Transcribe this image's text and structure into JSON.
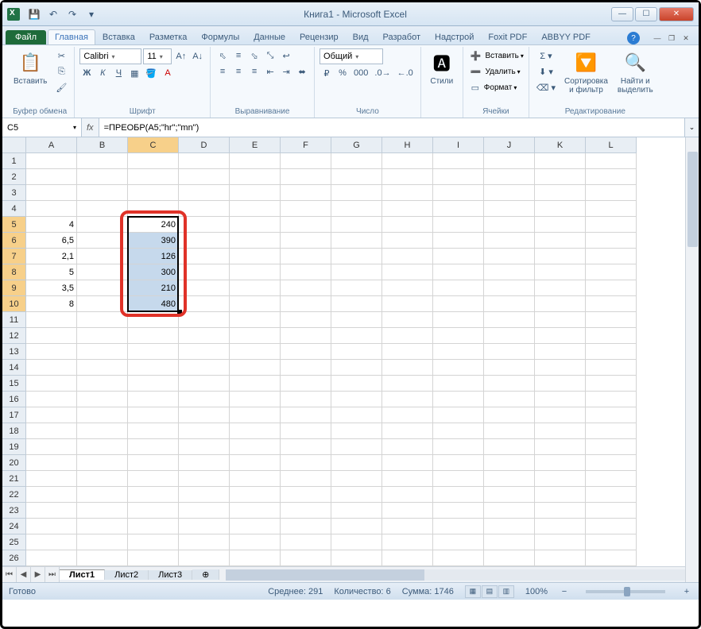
{
  "title": "Книга1  -  Microsoft Excel",
  "qat": {
    "save": "💾",
    "undo": "↶",
    "redo": "↷"
  },
  "tabs": {
    "file": "Файл",
    "items": [
      "Главная",
      "Вставка",
      "Разметка",
      "Формулы",
      "Данные",
      "Рецензир",
      "Вид",
      "Разработ",
      "Надстрой",
      "Foxit PDF",
      "ABBYY PDF"
    ],
    "active": 0,
    "help": "?"
  },
  "ribbon": {
    "clipboard": {
      "paste": "Вставить",
      "label": "Буфер обмена"
    },
    "font": {
      "name": "Calibri",
      "size": "11",
      "label": "Шрифт"
    },
    "align": {
      "label": "Выравнивание"
    },
    "number": {
      "format": "Общий",
      "label": "Число"
    },
    "styles": {
      "btn": "Стили",
      "label": ""
    },
    "cells": {
      "insert": "Вставить",
      "delete": "Удалить",
      "format": "Формат",
      "label": "Ячейки"
    },
    "editing": {
      "sort": "Сортировка\nи фильтр",
      "find": "Найти и\nвыделить",
      "label": "Редактирование"
    }
  },
  "formula_bar": {
    "name_box": "C5",
    "fx": "fx",
    "formula": "=ПРЕОБР(A5;\"hr\";\"mn\")"
  },
  "grid": {
    "cols": [
      "A",
      "B",
      "C",
      "D",
      "E",
      "F",
      "G",
      "H",
      "I",
      "J",
      "K",
      "L"
    ],
    "rows": 27,
    "selected_col": "C",
    "selected_rows_from": 5,
    "selected_rows_to": 10,
    "data_a": {
      "5": "4",
      "6": "6,5",
      "7": "2,1",
      "8": "5",
      "9": "3,5",
      "10": "8"
    },
    "data_c": {
      "5": "240",
      "6": "390",
      "7": "126",
      "8": "300",
      "9": "210",
      "10": "480"
    }
  },
  "sheets": {
    "tabs": [
      "Лист1",
      "Лист2",
      "Лист3"
    ],
    "active": 0
  },
  "status": {
    "ready": "Готово",
    "avg_label": "Среднее:",
    "avg": "291",
    "count_label": "Количество:",
    "count": "6",
    "sum_label": "Сумма:",
    "sum": "1746",
    "zoom": "100%"
  }
}
